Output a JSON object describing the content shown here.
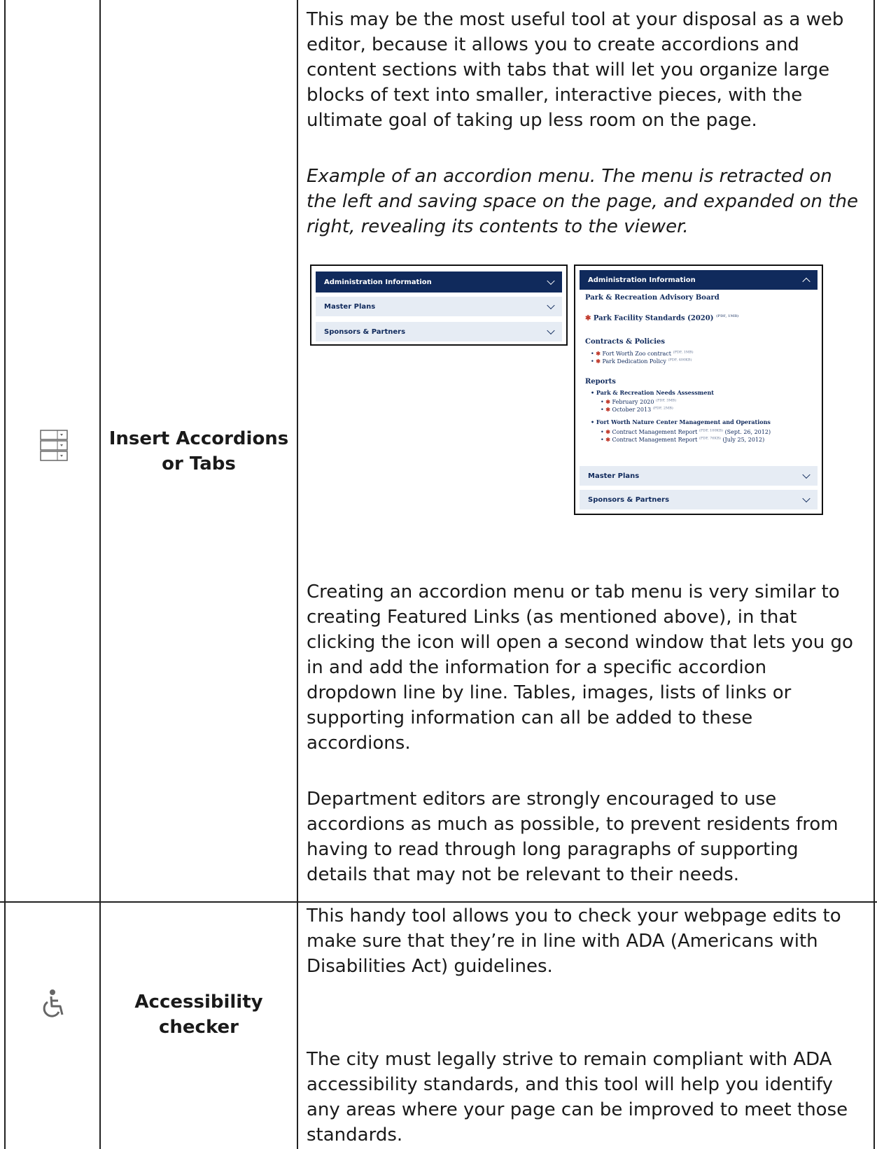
{
  "rows": [
    {
      "icon": "accordion-icon",
      "label_line1": "Insert Accordions",
      "label_line2": "or Tabs",
      "para1": "This may be the most useful tool at your disposal as a web editor, because it allows you to create accordions and content sections with tabs that will let you organize large blocks of text into smaller, interactive pieces, with the ultimate goal of taking up less room on the page.",
      "caption": "Example of an accordion menu. The menu is retracted on the left and saving space on the page, and expanded on the right, revealing its contents to the viewer.",
      "para2": "Creating an accordion menu or tab menu is very similar to creating Featured Links (as mentioned above), in that clicking the icon will open a second window that lets you go in and add the information for a specific accordion dropdown line by line. Tables, images, lists of links or supporting information can all be added to these accordions.",
      "para3": "Department editors are strongly encouraged to use accordions as much as possible, to prevent residents from having to read through long paragraphs of supporting details that may not be relevant to their needs."
    },
    {
      "icon": "wheelchair-icon",
      "label_line1": "Accessibility",
      "label_line2": "checker",
      "para1": "This handy tool allows you to check your webpage edits to make sure that they’re in line with ADA (Americans with Disabilities Act) guidelines.",
      "para2": "The city must legally strive to remain compliant with ADA accessibility standards, and this tool will help you identify any areas where your page can be improved to meet those standards."
    }
  ],
  "accordion_collapsed": {
    "items": [
      "Administration Information",
      "Master Plans",
      "Sponsors & Partners"
    ]
  },
  "accordion_expanded": {
    "header": "Administration Information",
    "board": "Park & Recreation Advisory Board",
    "standards": "Park Facility Standards (2020)",
    "standards_tag": "(PDF, 1MB)",
    "contracts_heading": "Contracts & Policies",
    "contracts": [
      {
        "text": "Fort Worth Zoo contract",
        "tag": "(PDF, 1MB)"
      },
      {
        "text": "Park Dedication Policy",
        "tag": "(PDF, 400KB)"
      }
    ],
    "reports_heading": "Reports",
    "needs_heading": "Park & Recreation Needs Assessment",
    "needs": [
      {
        "text": "February 2020",
        "tag": "(PDF, 3MB)"
      },
      {
        "text": "October 2013",
        "tag": "(PDF, 2MB)"
      }
    ],
    "nature_heading": "Fort Worth Nature Center Management and Operations",
    "nature": [
      {
        "text": "Contract Management Report",
        "tag": "(PDF, 100KB)",
        "date": "(Sept. 26, 2012)"
      },
      {
        "text": "Contract Management Report",
        "tag": "(PDF, 76KB)",
        "date": "(July 25, 2012)"
      }
    ],
    "footer_items": [
      "Master Plans",
      "Sponsors & Partners"
    ]
  }
}
